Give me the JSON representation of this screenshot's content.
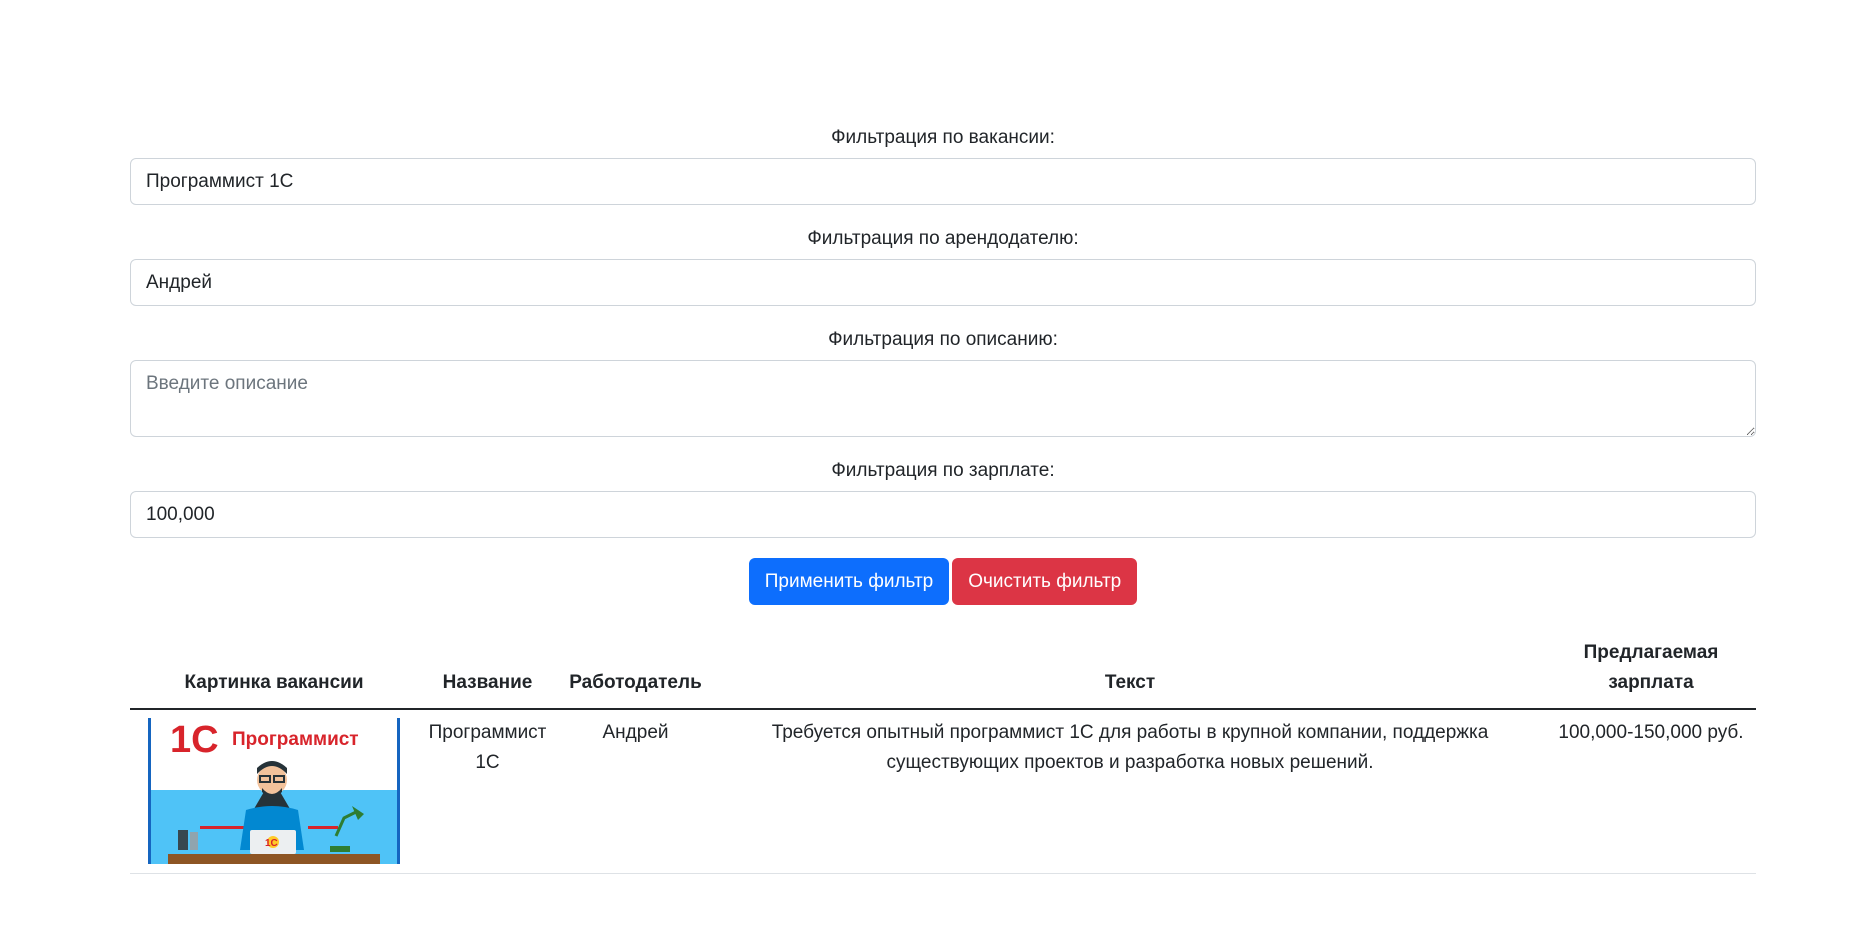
{
  "filters": {
    "vacancy": {
      "label": "Фильтрация по вакансии:",
      "value": "Программист 1С"
    },
    "employer": {
      "label": "Фильтрация по арендодателю:",
      "value": "Андрей"
    },
    "description": {
      "label": "Фильтрация по описанию:",
      "value": "",
      "placeholder": "Введите описание"
    },
    "salary": {
      "label": "Фильтрация по зарплате:",
      "value": "100,000"
    },
    "apply_label": "Применить фильтр",
    "clear_label": "Очистить фильтр"
  },
  "table": {
    "headers": {
      "image": "Картинка вакансии",
      "name": "Название",
      "employer": "Работодатель",
      "text": "Текст",
      "salary": "Предлагаемая зарплата"
    },
    "rows": [
      {
        "image_logo": "1С",
        "image_caption": "Программист",
        "name": "Программист 1С",
        "employer": "Андрей",
        "text": "Требуется опытный программист 1С для работы в крупной компании, поддержка существующих проектов и разработка новых решений.",
        "salary": "100,000-150,000 руб."
      }
    ]
  },
  "colors": {
    "primary": "#0d6efd",
    "danger": "#dc3545",
    "logo_red": "#d8242b",
    "image_sky": "#4fc3f7"
  }
}
